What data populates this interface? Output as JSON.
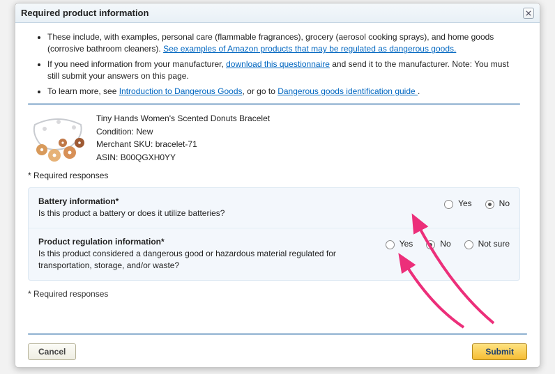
{
  "dialog": {
    "title": "Required product information"
  },
  "intro": {
    "bullet1_pre": "These include, with examples, personal care (flammable fragrances), grocery (aerosol cooking sprays), and home goods (corrosive bathroom cleaners). ",
    "bullet1_link": "See examples of Amazon products that may be regulated as dangerous goods.",
    "bullet2_pre": "If you need information from your manufacturer, ",
    "bullet2_link": "download this questionnaire",
    "bullet2_post": " and send it to the manufacturer. Note: You must still submit your answers on this page.",
    "bullet3_pre": "To learn more, see ",
    "bullet3_link1": "Introduction to Dangerous Goods",
    "bullet3_mid": ", or go to ",
    "bullet3_link2": "Dangerous goods identification guide ",
    "bullet3_post": "."
  },
  "product": {
    "name": "Tiny Hands Women's Scented Donuts Bracelet",
    "condition_label": "Condition: ",
    "condition_value": "New",
    "sku_label": "Merchant SKU: ",
    "sku_value": "bracelet-71",
    "asin_label": "ASIN: ",
    "asin_value": "B00QGXH0YY"
  },
  "required_legend": "* Required responses",
  "questions": {
    "battery": {
      "title": "Battery information*",
      "desc": "Is this product a battery or does it utilize batteries?",
      "yes": "Yes",
      "no": "No"
    },
    "regulation": {
      "title": "Product regulation information*",
      "desc": "Is this product considered a dangerous good or hazardous material regulated for transportation, storage, and/or waste?",
      "yes": "Yes",
      "no": "No",
      "notsure": "Not sure"
    }
  },
  "buttons": {
    "cancel": "Cancel",
    "submit": "Submit"
  }
}
